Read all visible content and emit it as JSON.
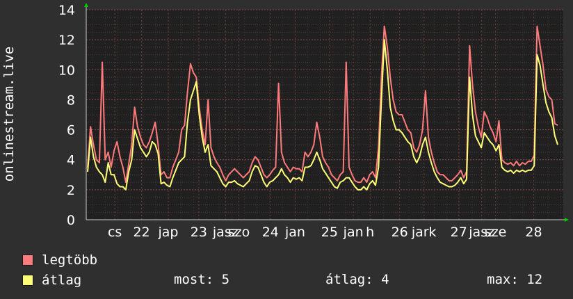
{
  "chart_data": {
    "type": "line",
    "ylabel": "onlinestream.live",
    "ylim": [
      0,
      14
    ],
    "yticks": [
      "0",
      "2",
      "4",
      "6",
      "8",
      "10",
      "12",
      "14"
    ],
    "x_tick_labels": [
      "cs",
      "22",
      "jap",
      "23",
      "jasz",
      "szo",
      "24",
      "jan",
      "25",
      "jan",
      "h",
      "26",
      "jark",
      "27",
      "jasz",
      "sze",
      "28"
    ],
    "x_tick_pos": [
      0.06,
      0.116,
      0.172,
      0.236,
      0.292,
      0.32,
      0.386,
      0.438,
      0.51,
      0.56,
      0.595,
      0.657,
      0.708,
      0.781,
      0.829,
      0.858,
      0.938
    ],
    "series": [
      {
        "name": "legtöbb",
        "color": "#ff7b7b",
        "values": [
          3.5,
          6.2,
          5,
          4,
          3.8,
          10.5,
          4,
          4.5,
          3.5,
          4.6,
          5.2,
          4.2,
          3.5,
          2.5,
          3.7,
          5,
          7.5,
          6.2,
          5.5,
          5,
          4.8,
          5.2,
          5.8,
          6.5,
          5,
          3,
          3.2,
          2.8,
          2.8,
          3.5,
          4,
          4.5,
          6,
          6.3,
          8.5,
          10.4,
          9.8,
          9.5,
          7.5,
          6,
          5,
          8,
          4.8,
          4.2,
          3.8,
          3.5,
          3,
          2.6,
          3,
          3.2,
          3.4,
          3.2,
          3,
          2.8,
          3,
          3.2,
          3.8,
          4.2,
          4,
          3.5,
          3,
          2.8,
          3,
          3.3,
          3.5,
          9.1,
          4.5,
          3.8,
          3.5,
          3.2,
          3.5,
          3.4,
          3.4,
          3.2,
          4.5,
          4.2,
          4.5,
          5,
          6.5,
          5.5,
          4.2,
          3.8,
          3.5,
          3,
          2.8,
          2.6,
          3,
          3.2,
          10.5,
          3.5,
          3,
          2.6,
          2.5,
          2.5,
          2.8,
          2.5,
          3,
          3.2,
          2.8,
          4.8,
          9.5,
          12.9,
          11.5,
          9.5,
          8,
          7.2,
          7,
          7,
          6.5,
          6,
          5.8,
          4.8,
          4.5,
          5,
          6,
          8.6,
          5.5,
          4.5,
          3.8,
          3.2,
          3,
          3,
          2.8,
          2.6,
          2.6,
          2.8,
          3,
          3.3,
          2.8,
          3.2,
          11.6,
          9,
          7.2,
          6.2,
          5.5,
          7.2,
          6.8,
          6.2,
          5.8,
          5.2,
          6.6,
          4,
          3.8,
          3.7,
          3.8,
          3.6,
          3.9,
          3.6,
          3.8,
          3.7,
          3.9,
          3.9,
          4.3,
          12.9,
          11.6,
          10.3,
          8.7,
          8.2,
          8,
          6.4,
          6.3
        ],
        "peak_spikes": [
          [
            2,
            6.2
          ],
          [
            5,
            10.5
          ],
          [
            16,
            7.5
          ],
          [
            35,
            10.4
          ],
          [
            41,
            8
          ],
          [
            65,
            9.1
          ],
          [
            88,
            10.5
          ],
          [
            101,
            12.9
          ],
          [
            115,
            8.6
          ],
          [
            128,
            11.6
          ],
          [
            152,
            12.9
          ]
        ]
      },
      {
        "name": "átlag",
        "color": "#ffff77",
        "values": [
          3.2,
          5.5,
          4.2,
          3.5,
          3.2,
          3,
          2.5,
          3.8,
          3,
          3,
          2.4,
          2.2,
          2.2,
          2,
          3.2,
          4,
          6,
          5.4,
          4.8,
          4.5,
          4.2,
          4.5,
          5.2,
          5,
          4.4,
          2.4,
          2.5,
          2.3,
          2.2,
          2.8,
          3.3,
          3.8,
          4,
          4.2,
          6.5,
          8,
          8.6,
          9.2,
          7,
          5.5,
          4.5,
          5,
          3.6,
          3.4,
          3.2,
          2.8,
          2.4,
          2.2,
          2.5,
          2.5,
          2.6,
          2.4,
          2.3,
          2.2,
          2.4,
          2.6,
          3.2,
          3.6,
          3.5,
          3,
          2.5,
          2.2,
          2.5,
          2.6,
          2.8,
          3,
          3.4,
          3,
          2.8,
          2.5,
          2.8,
          2.7,
          2.8,
          2.6,
          3.5,
          3.5,
          3.6,
          4,
          4.5,
          4,
          3.4,
          3.1,
          2.8,
          2.5,
          2.2,
          2.1,
          2.5,
          2.6,
          2.8,
          2.8,
          2.5,
          2.2,
          2,
          2,
          2.2,
          2,
          2.4,
          2.6,
          2.3,
          3.5,
          8,
          12,
          10,
          7.5,
          6.6,
          6,
          6,
          5.8,
          5.5,
          5.2,
          5,
          4.2,
          3.8,
          4.2,
          5,
          5.5,
          4.5,
          3.8,
          3.2,
          2.8,
          2.5,
          2.4,
          2.3,
          2.2,
          2.2,
          2.3,
          2.5,
          2.8,
          2.4,
          2.7,
          9.5,
          7,
          5.6,
          5.2,
          4.8,
          5.8,
          5.5,
          5.2,
          5,
          4.6,
          5,
          3.5,
          3.3,
          3.2,
          3.3,
          3.1,
          3.3,
          3.2,
          3.3,
          3.2,
          3.3,
          3.3,
          3.6,
          11,
          10.3,
          9,
          7.8,
          7.2,
          6.8,
          5.6,
          5
        ],
        "peak_spikes": []
      }
    ],
    "grid": true,
    "legend_position": "bottom-left"
  },
  "legend": {
    "max_label": "legtöbb",
    "avg_label": "átlag",
    "stats": {
      "current": "most: 5",
      "average": "átlag: 4",
      "maximum": "max: 12"
    }
  }
}
